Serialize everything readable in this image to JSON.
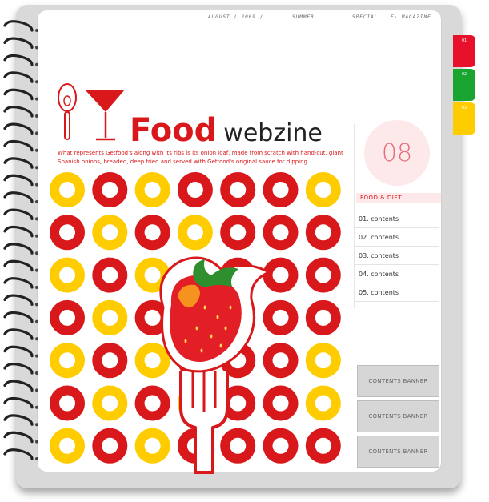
{
  "header": {
    "date": "AUGUST / 2009 /",
    "season": "SUMMER",
    "special": "SPECIAL",
    "magazine": "E· MAGAZINE"
  },
  "tabs": [
    {
      "label": "01",
      "color": "#e8102a"
    },
    {
      "label": "02",
      "color": "#1aa531"
    },
    {
      "label": "03",
      "color": "#ffcc00"
    }
  ],
  "title": {
    "food": "Food",
    "webzine": "webzine"
  },
  "tagline": "What represents Getfood's along with its ribs is its onion loaf, made from scratch with hand-cut, giant Spanish onions, breaded, deep fried and served with Getfood's original sauce for dipping.",
  "issue": {
    "number": "08",
    "category": "FOOD & DIET"
  },
  "contents": [
    "01. contents",
    "02. contents",
    "03. contents",
    "04. contents",
    "05. contents"
  ],
  "banners": [
    "CONTENTS BANNER",
    "CONTENTS BANNER",
    "CONTENTS BANNER"
  ],
  "colors": {
    "red": "#d9181b",
    "yellow": "#ffcc00",
    "pink": "#fde8ea"
  }
}
